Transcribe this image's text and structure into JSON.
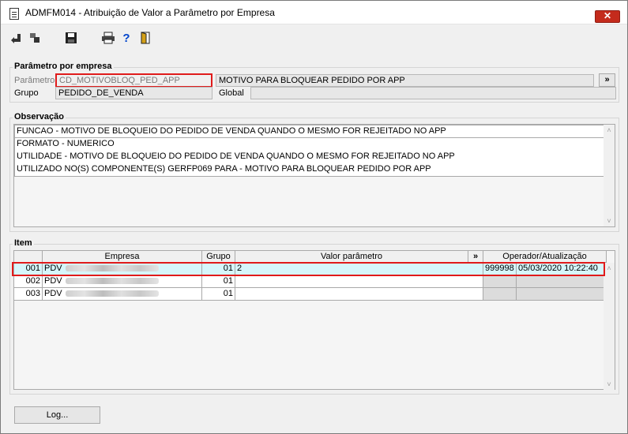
{
  "window": {
    "title": "ADMFM014 - Atribuição de Valor a Parâmetro por Empresa",
    "close_label": "✕"
  },
  "toolbar": {
    "back_icon": "navigate-back-icon",
    "forward_icon": "navigate-forward-icon",
    "save_icon": "save-icon",
    "print_icon": "print-icon",
    "help_label": "?",
    "exit_icon": "exit-door-icon"
  },
  "parametro": {
    "legend": "Parâmetro por empresa",
    "parametro_label": "Parâmetro",
    "parametro_value": "CD_MOTIVOBLOQ_PED_APP",
    "descricao_value": "MOTIVO PARA BLOQUEAR PEDIDO POR APP",
    "more_label": "»",
    "grupo_label": "Grupo",
    "grupo_value": "PEDIDO_DE_VENDA",
    "global_label": "Global",
    "global_value": ""
  },
  "observacao": {
    "legend": "Observação",
    "lines": [
      "FUNCAO - MOTIVO DE BLOQUEIO DO PEDIDO DE VENDA QUANDO O MESMO FOR REJEITADO NO APP",
      "FORMATO - NUMERICO",
      "UTILIDADE - MOTIVO DE BLOQUEIO DO PEDIDO DE VENDA QUANDO O MESMO FOR REJEITADO NO APP",
      "UTILIZADO NO(S) COMPONENTE(S) GERFP069  PARA  - MOTIVO PARA BLOQUEAR PEDIDO POR APP"
    ]
  },
  "item": {
    "legend": "Item",
    "headers": {
      "empresa": "Empresa",
      "grupo": "Grupo",
      "valor": "Valor parâmetro",
      "more": "»",
      "operador": "Operador/Atualização"
    },
    "rows": [
      {
        "num": "001",
        "empresa": "PDV",
        "grupo": "01",
        "valor": "2",
        "operador": "999998",
        "atualizacao": "05/03/2020 10:22:40"
      },
      {
        "num": "002",
        "empresa": "PDV",
        "grupo": "01",
        "valor": "",
        "operador": "",
        "atualizacao": ""
      },
      {
        "num": "003",
        "empresa": "PDV",
        "grupo": "01",
        "valor": "",
        "operador": "",
        "atualizacao": ""
      }
    ]
  },
  "footer": {
    "log_label": "Log..."
  },
  "colors": {
    "highlight": "#e01b1b",
    "selected_row": "#d6f6fb",
    "close_button": "#c42b1c"
  }
}
